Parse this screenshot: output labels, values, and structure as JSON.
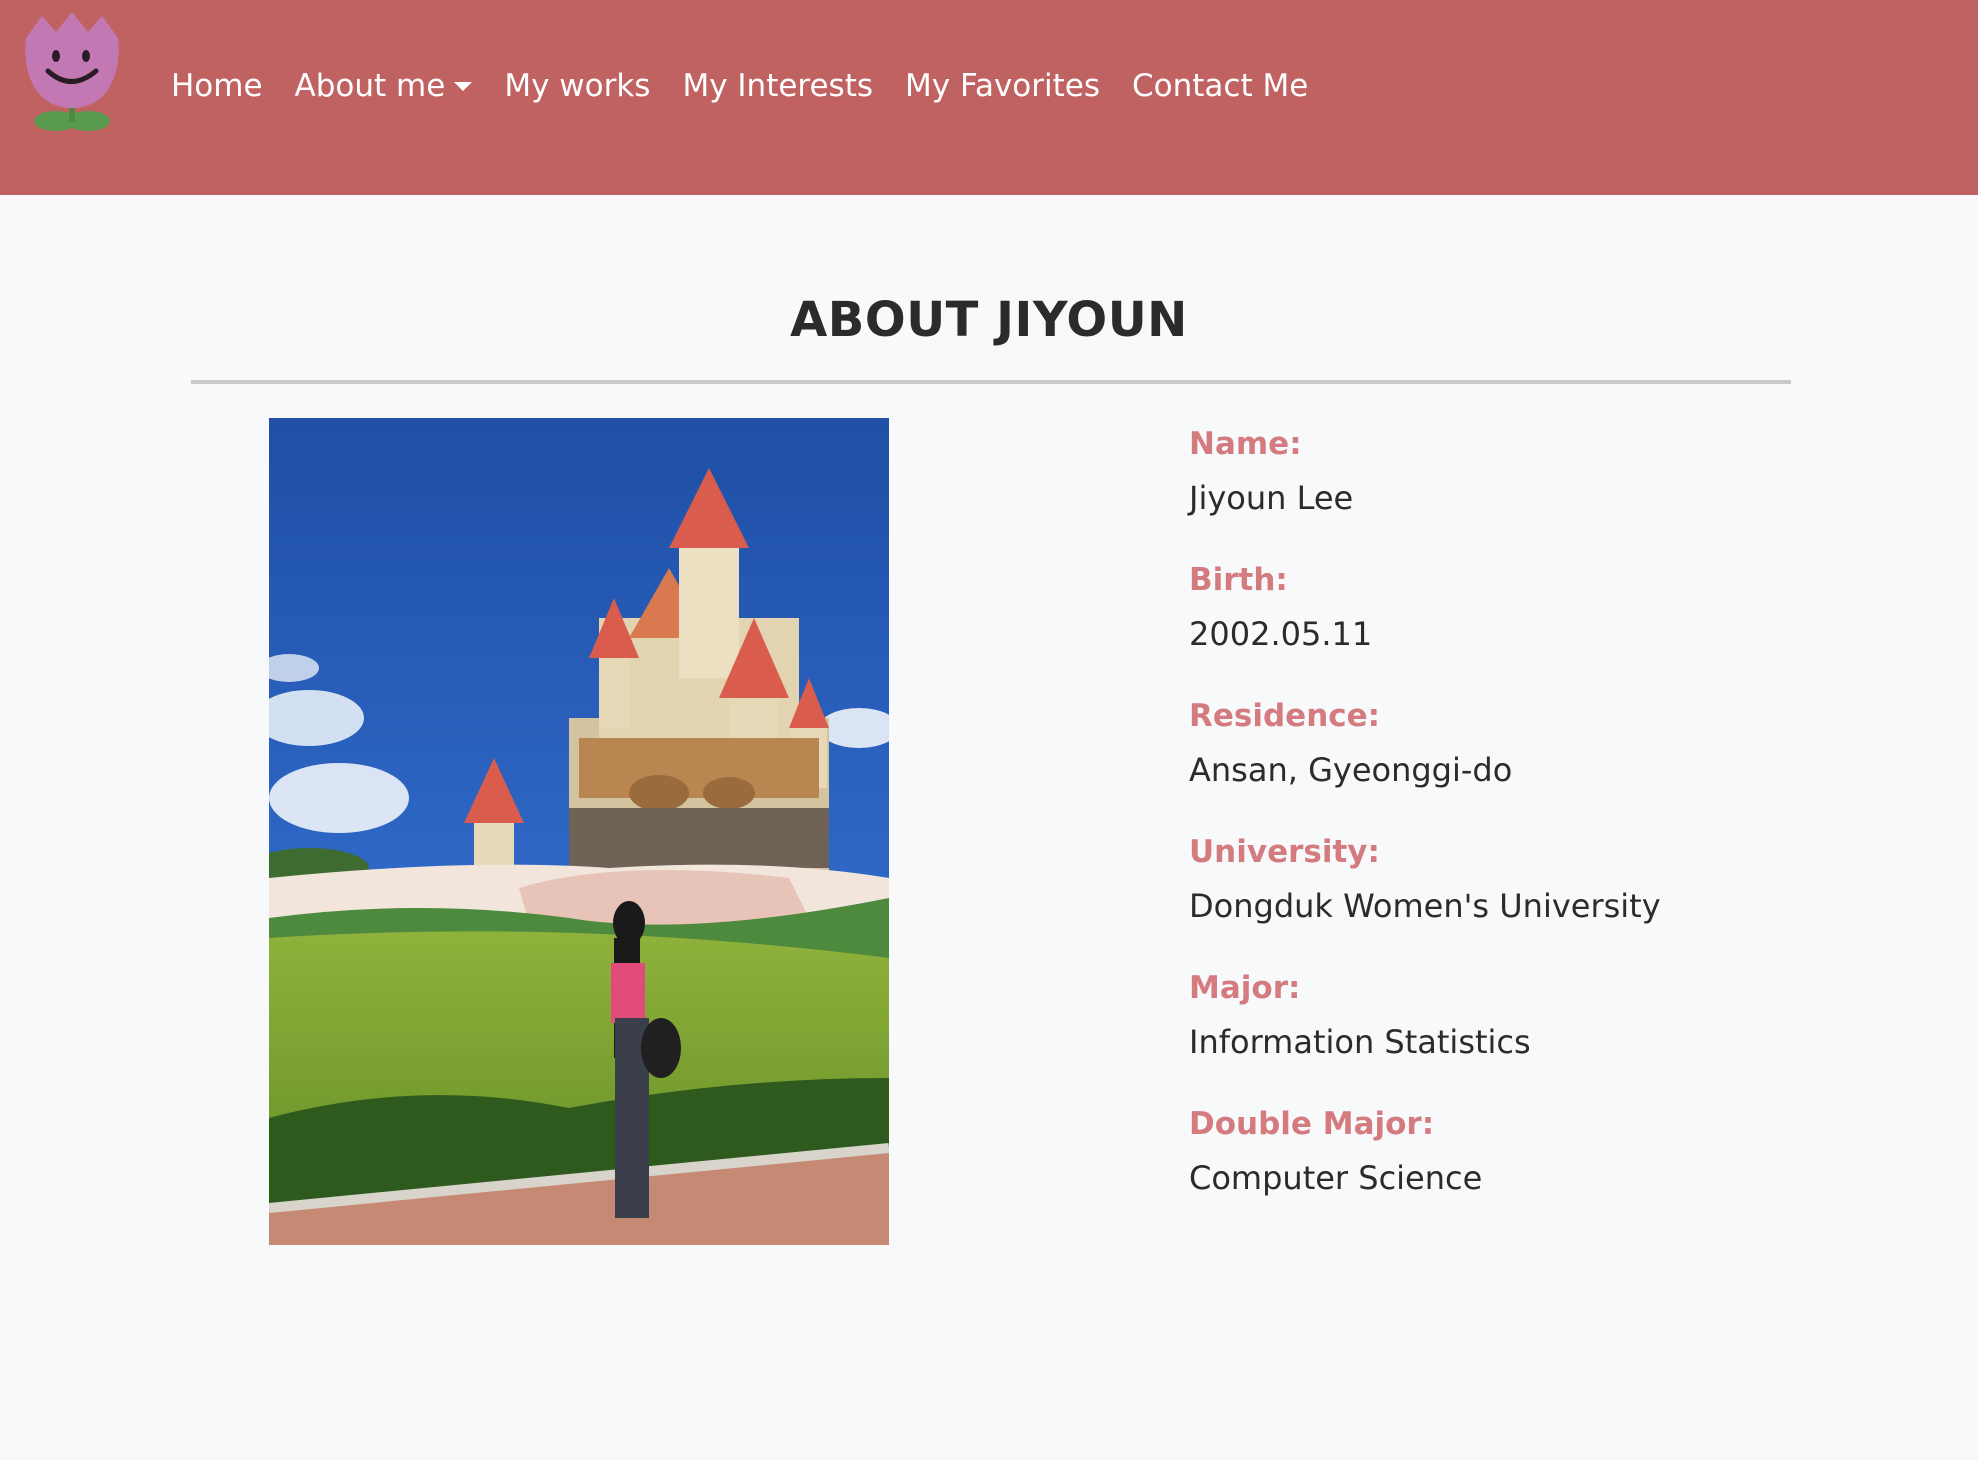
{
  "nav": {
    "logo_icon": "smiling-tulip-logo-icon",
    "items": [
      {
        "label": "Home"
      },
      {
        "label": "About me",
        "dropdown": true
      },
      {
        "label": "My works"
      },
      {
        "label": "My Interests"
      },
      {
        "label": "My Favorites"
      },
      {
        "label": "Contact Me"
      }
    ]
  },
  "page": {
    "title": "ABOUT JIYOUN"
  },
  "profile": {
    "photo_icon": "castle-garden-photo",
    "fields": [
      {
        "label": "Name:",
        "value": "Jiyoun Lee"
      },
      {
        "label": "Birth:",
        "value": "2002.05.11"
      },
      {
        "label": "Residence:",
        "value": "Ansan, Gyeonggi-do"
      },
      {
        "label": "University:",
        "value": "Dongduk Women's University"
      },
      {
        "label": "Major:",
        "value": "Information Statistics"
      },
      {
        "label": "Double Major:",
        "value": "Computer Science"
      }
    ]
  },
  "colors": {
    "navbar": "#c06262",
    "label": "#d47b80",
    "background": "#f8f9fa"
  }
}
